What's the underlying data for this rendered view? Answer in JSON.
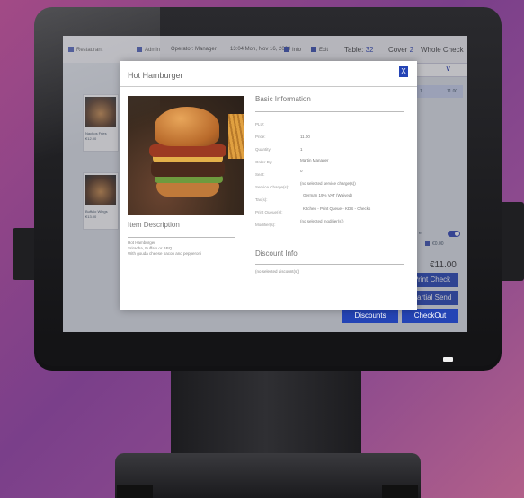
{
  "topbar": {
    "restaurant": "Restaurant",
    "admin": "Admin",
    "operator": "Operator: Manager",
    "datetime": "13:04 Mon, Nov 16, 2020",
    "info": "Info",
    "exit": "Exit",
    "table_label": "Table:",
    "table_value": "32",
    "cover_label": "Cover",
    "cover_value": "2",
    "whole_check": "Whole Check"
  },
  "order": {
    "qty": "1",
    "price": "11.00"
  },
  "menu_items": [
    {
      "name": "Nachos Fries",
      "price": "€12.00"
    },
    {
      "name": "Buffalo Wings",
      "price": "€13.00"
    }
  ],
  "summary": {
    "toggle_label": "e",
    "subtotal": "€0.00",
    "total": "€11.00"
  },
  "buttons": {
    "print_check": "Print Check",
    "partial_send": "Partial Send",
    "discounts": "Discounts",
    "checkout": "CheckOut"
  },
  "modal": {
    "title": "Hot Hamburger",
    "close": "X",
    "basic_info_title": "Basic Information",
    "fields": [
      {
        "label": "PLU:",
        "value": ""
      },
      {
        "label": "Price:",
        "value": "11.00"
      },
      {
        "label": "Quantity:",
        "value": "1"
      },
      {
        "label": "Order By:",
        "value": "Martin Manager"
      },
      {
        "label": "Seat:",
        "value": "0"
      },
      {
        "label": "Service Charge(s):",
        "value": "(no selected service charge(s))"
      },
      {
        "label": "Tax(s):",
        "value": "German 19% VAT (Waived)"
      },
      {
        "label": "Print Queue(s):",
        "value": "Kitchen - Print Queue - KDS - Checks"
      },
      {
        "label": "Modifier(s):",
        "value": "(no selected modifier(s))"
      }
    ],
    "item_desc_title": "Item Description",
    "item_desc_lines": [
      "Hot Hamburger",
      "Sriracha, Buffalo or BBQ",
      "With gouda cheese bacon and pepperoni"
    ],
    "discount_title": "Discount Info",
    "discount_text": "(no selected discount(s))"
  }
}
